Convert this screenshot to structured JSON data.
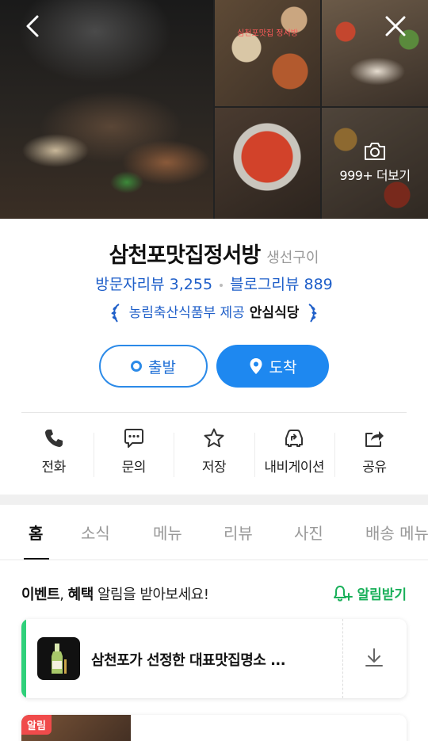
{
  "header": {
    "photo_overlay_text": "심천포맛집 정서방",
    "more_photos_label": "999+ 더보기"
  },
  "place": {
    "name": "삼천포맛집정서방",
    "category": "생선구이",
    "visitor_reviews": "방문자리뷰 3,255",
    "blog_reviews": "블로그리뷰 889",
    "badge_provider": "농림축산식품부 제공",
    "badge_name": "안심식당"
  },
  "route": {
    "depart_label": "출발",
    "arrive_label": "도착"
  },
  "actions": [
    {
      "label": "전화",
      "icon": "phone-icon"
    },
    {
      "label": "문의",
      "icon": "chat-icon"
    },
    {
      "label": "저장",
      "icon": "star-icon"
    },
    {
      "label": "내비게이션",
      "icon": "navigation-car-icon"
    },
    {
      "label": "공유",
      "icon": "share-icon"
    }
  ],
  "tabs": [
    {
      "label": "홈",
      "active": true
    },
    {
      "label": "소식"
    },
    {
      "label": "메뉴"
    },
    {
      "label": "리뷰"
    },
    {
      "label": "사진"
    },
    {
      "label": "배송 메뉴"
    }
  ],
  "notice": {
    "bold1": "이벤트",
    "comma": ", ",
    "bold2": "혜택",
    "rest": " 알림을 받아보세요!",
    "subscribe_label": "알림받기"
  },
  "card": {
    "title": "삼천포가 선정한 대표맛집명소 ..."
  },
  "card2": {
    "badge": "알림"
  },
  "colors": {
    "accent_blue": "#1e88f0",
    "review_blue": "#1f5fc9",
    "green": "#1ab05a",
    "card_bar_green": "#2fd07a",
    "alert_red": "#f04b4b"
  }
}
